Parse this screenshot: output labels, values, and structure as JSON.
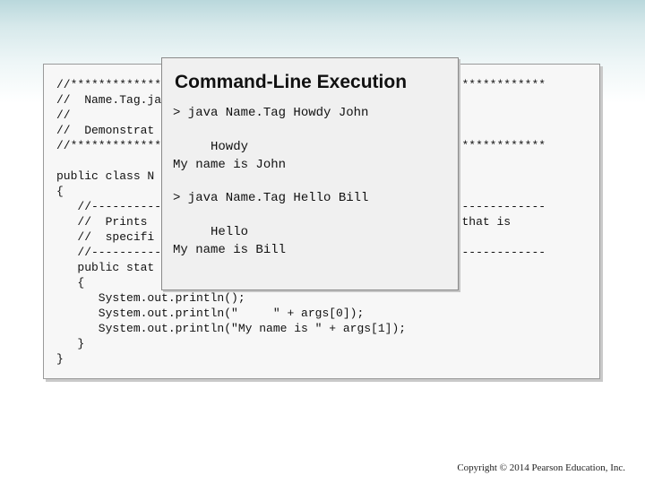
{
  "code_lines": [
    "//********************************************************************",
    "//  Name.Tag.java",
    "//",
    "//  Demonstrat",
    "//********************************************************************",
    "",
    "public class N",
    "{",
    "   //-----------------------------------------------------------------",
    "   //  Prints                                      a name that is",
    "   //  specifi",
    "   //-----------------------------------------------------------------",
    "   public stat",
    "   {",
    "      System.out.println();",
    "      System.out.println(\"     \" + args[0]);",
    "      System.out.println(\"My name is \" + args[1]);",
    "   }",
    "}"
  ],
  "popup": {
    "title": "Command-Line Execution",
    "command1": "> java Name.Tag Howdy John",
    "output1_line1": "     Howdy",
    "output1_line2": "My name is John",
    "command2": "> java Name.Tag Hello Bill",
    "output2_line1": "     Hello",
    "output2_line2": "My name is Bill"
  },
  "footer": {
    "copyright": "Copyright © 2014 Pearson Education, Inc."
  }
}
